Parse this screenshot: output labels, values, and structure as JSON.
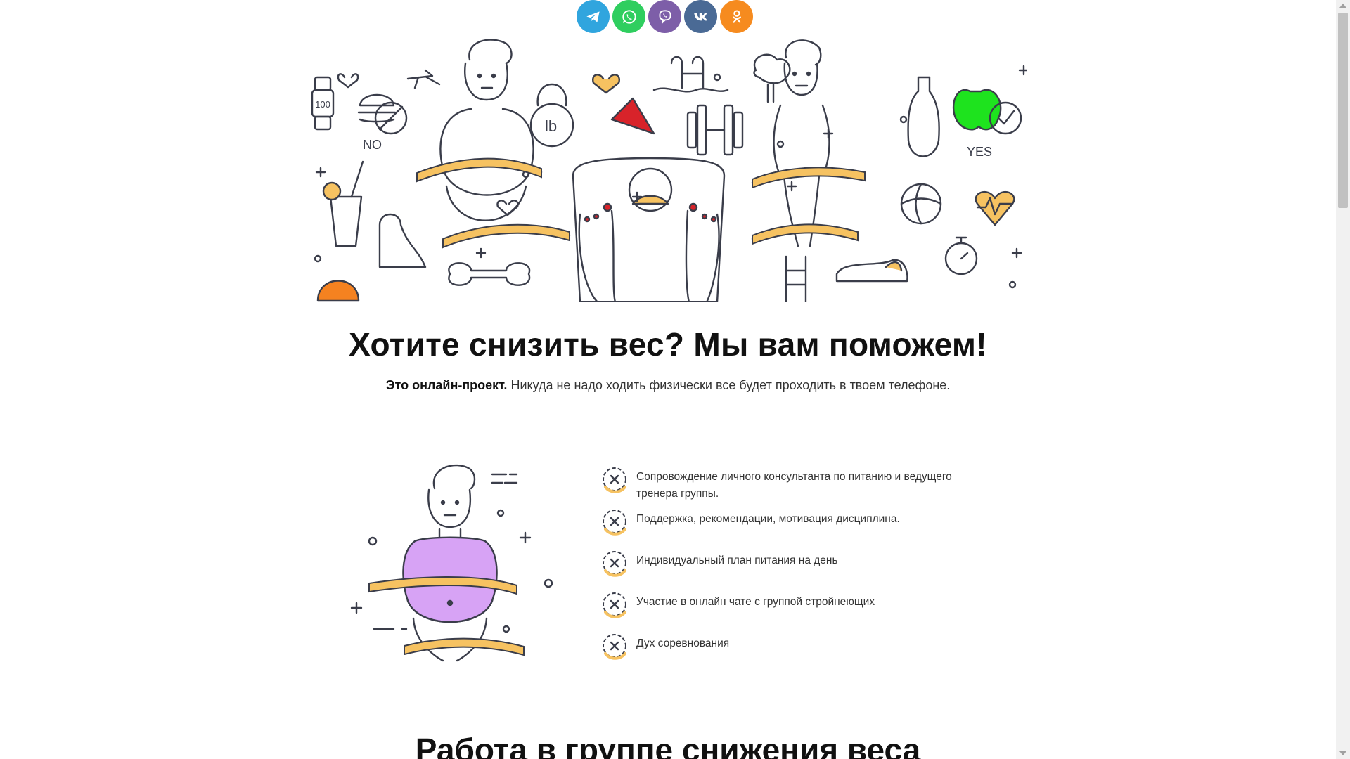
{
  "social": [
    {
      "name": "telegram",
      "icon": "telegram-icon",
      "color": "#30a5de"
    },
    {
      "name": "whatsapp",
      "icon": "whatsapp-icon",
      "color": "#2fce5f"
    },
    {
      "name": "viber",
      "icon": "viber-icon",
      "color": "#7d5ea8"
    },
    {
      "name": "vk",
      "icon": "vk-icon",
      "color": "#4a6a95"
    },
    {
      "name": "odnoklassniki",
      "icon": "odnoklassniki-icon",
      "color": "#f68b1f"
    }
  ],
  "hero": {
    "labels": {
      "watch": "100",
      "no": "NO",
      "yes": "YES",
      "weight": "lb"
    }
  },
  "headline": "Хотите снизить вес? Мы вам поможем!",
  "subline": {
    "bold": "Это онлайн-проект.",
    "text": " Никуда не надо ходить физически все будет проходить в твоем телефоне."
  },
  "features": [
    {
      "text": "Сопровождение личного консультанта по питанию и ведущего тренера группы."
    },
    {
      "text": "Поддержка, рекомендации, мотивация дисциплина."
    },
    {
      "text": "Индивидуальный план питания на день"
    },
    {
      "text": "Участие в онлайн чате с группой стройнеющих"
    },
    {
      "text": "Дух соревнования"
    }
  ],
  "section2_title": "Работа в группе снижения веса",
  "colors": {
    "accent_yellow": "#f6c261",
    "accent_purple": "#d7a3f5",
    "accent_green": "#1ee31e",
    "accent_orange": "#f58220",
    "accent_red": "#d8232a",
    "line": "#3a3d4a"
  }
}
